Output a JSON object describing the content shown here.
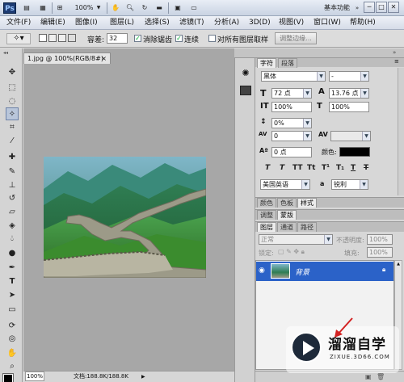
{
  "appbar": {
    "logo": "Ps",
    "zoom": "100%",
    "workspace": "基本功能",
    "win_min": "─",
    "win_max": "□",
    "win_close": "✕"
  },
  "menu": [
    "文件(F)",
    "编辑(E)",
    "图像(I)",
    "图层(L)",
    "选择(S)",
    "滤镜(T)",
    "分析(A)",
    "3D(D)",
    "视图(V)",
    "窗口(W)",
    "帮助(H)"
  ],
  "options": {
    "tolerance_label": "容差:",
    "tolerance_value": "32",
    "antialias_label": "消除锯齿",
    "contiguous_label": "连续",
    "sample_all_label": "对所有图层取样",
    "refine_edge_label": "调整边缘..."
  },
  "document": {
    "tab_title": "1.jpg @ 100%(RGB/8#)",
    "tab_close": "×",
    "zoom": "100%",
    "doc_info": "文档:188.8K/188.8K"
  },
  "character_panel": {
    "tabs": [
      "字符",
      "段落"
    ],
    "font_family": "黑体",
    "font_style": "-",
    "font_size": "72 点",
    "leading": "13.76 点",
    "vertical_scale": "100%",
    "horizontal_scale": "100%",
    "tracking_ratio": "0%",
    "kerning": "0",
    "baseline_shift": "0 点",
    "color_label": "颜色:",
    "style_buttons": [
      "T",
      "T",
      "TT",
      "Tt",
      "T¹",
      "T₁",
      "T",
      "T"
    ],
    "language": "美国英语",
    "antialias": "锐利",
    "aa_icon": "a"
  },
  "panel_groups": {
    "group1_tabs": [
      "颜色",
      "色板",
      "样式"
    ],
    "group2_tabs": [
      "调整",
      "蒙版"
    ]
  },
  "layers_panel": {
    "tabs": [
      "图层",
      "通道",
      "路径"
    ],
    "blend_mode": "正常",
    "opacity_label": "不透明度:",
    "opacity": "100%",
    "lock_label": "锁定:",
    "fill_label": "填充:",
    "fill": "100%",
    "layers": [
      {
        "name": "背景",
        "visible": true,
        "locked": true
      }
    ]
  },
  "watermark": {
    "title": "溜溜自学",
    "subtitle": "ZIXUE.3D66.COM"
  },
  "colors": {
    "accent": "#2b62c8",
    "foreground": "#000000",
    "background": "#ffffff"
  }
}
